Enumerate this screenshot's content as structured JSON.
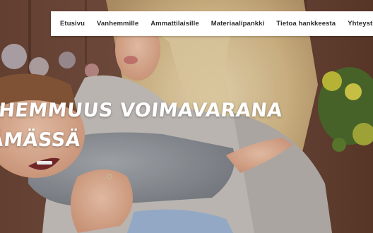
{
  "nav": {
    "items": [
      {
        "label": "Etusivu",
        "name": "nav-item-etusivu"
      },
      {
        "label": "Vanhemmille",
        "name": "nav-item-vanhemmille"
      },
      {
        "label": "Ammattilaisille",
        "name": "nav-item-ammattilaisille"
      },
      {
        "label": "Materiaalipankki",
        "name": "nav-item-materiaalipankki"
      },
      {
        "label": "Tietoa hankkeesta",
        "name": "nav-item-tietoa-hankkeesta"
      },
      {
        "label": "Yhteystiedot",
        "name": "nav-item-yhteystiedot"
      }
    ]
  },
  "hero": {
    "headline_line1": "HEMMUUS VOIMAVARANA",
    "headline_line2": "ÄMÄSSÄ",
    "image_subject": "mother-hugging-laughing-child-photo"
  },
  "colors": {
    "nav_background": "#ffffff",
    "nav_text": "#2b2b2b",
    "headline_text": "#ffffff"
  }
}
